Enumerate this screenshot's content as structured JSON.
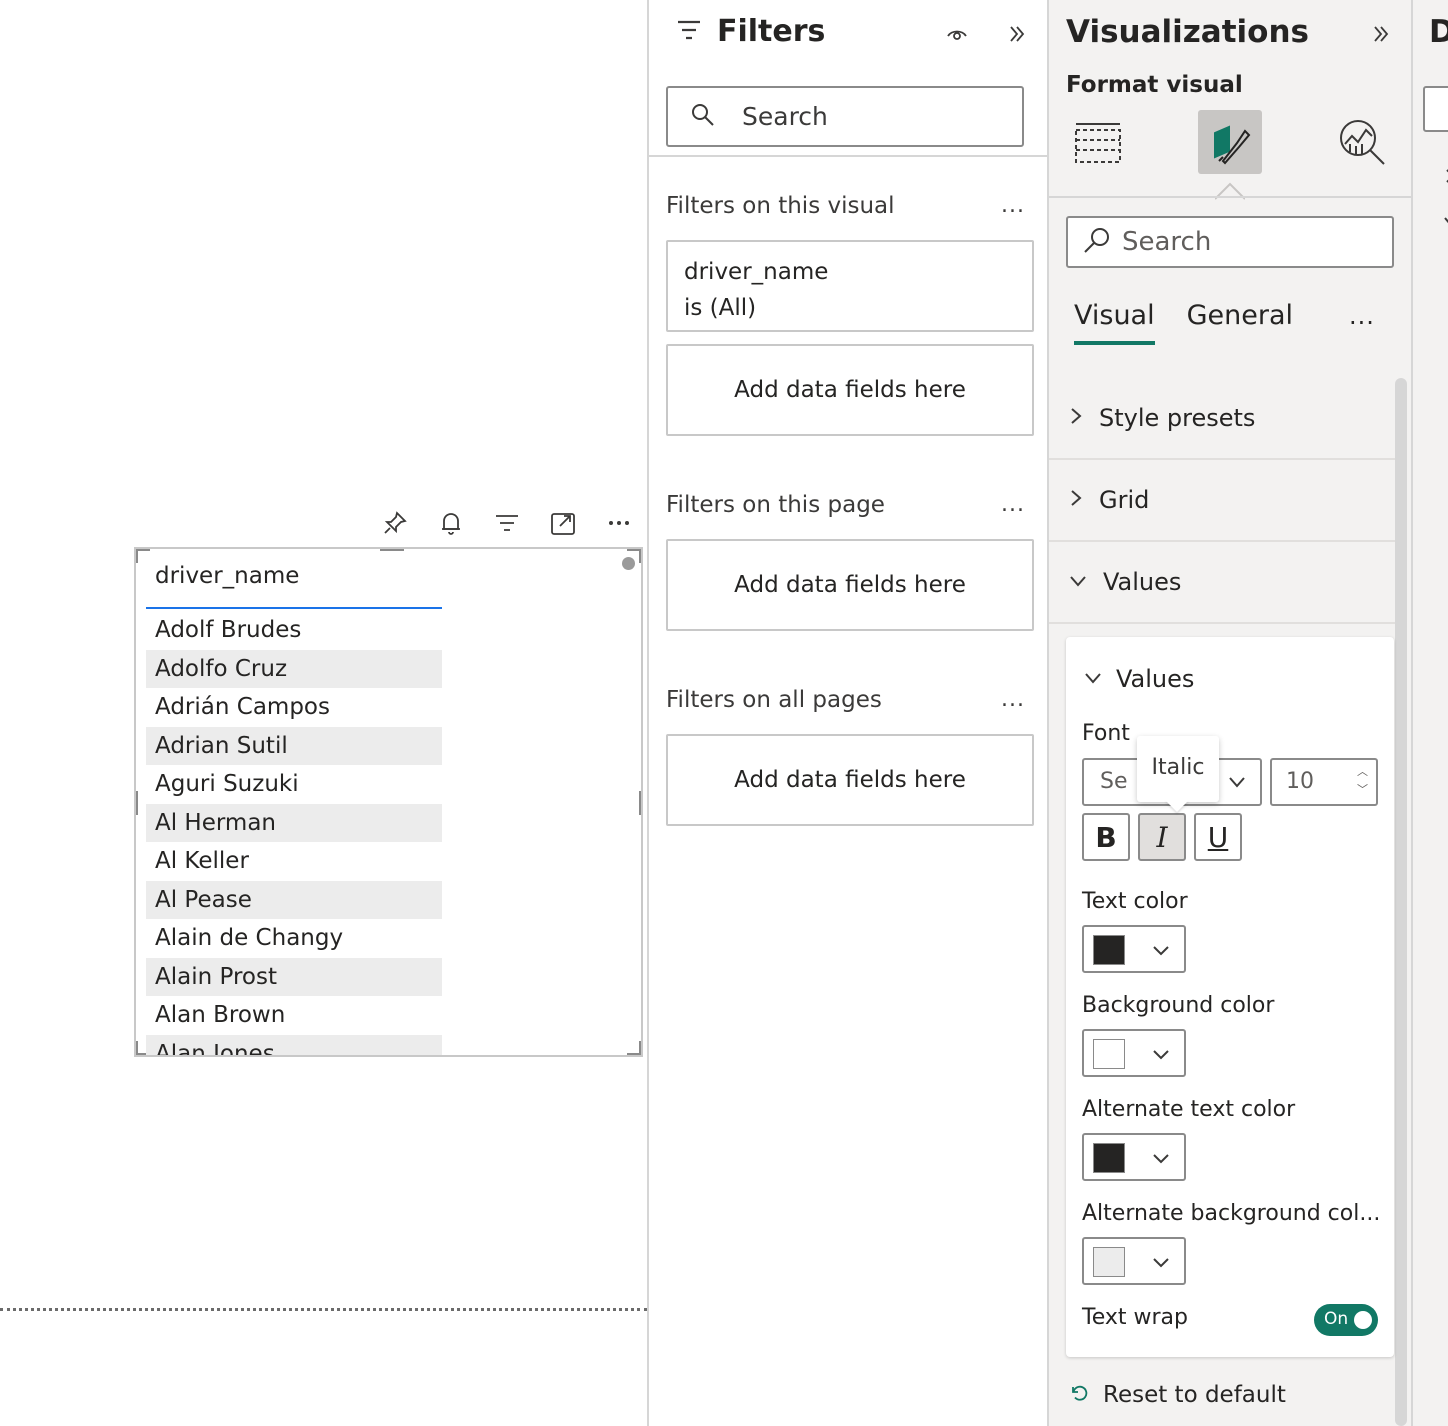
{
  "canvas": {
    "slicer": {
      "header": "driver_name",
      "items": [
        "Adolf Brudes",
        "Adolfo Cruz",
        "Adrián Campos",
        "Adrian Sutil",
        "Aguri Suzuki",
        "Al Herman",
        "Al Keller",
        "Al Pease",
        "Alain de Changy",
        "Alain Prost",
        "Alan Brown",
        "Alan Jones"
      ]
    },
    "visual_header_icons": [
      "pin-icon",
      "bell-icon",
      "filter-icon",
      "focus-mode-icon",
      "more-options-icon"
    ]
  },
  "filters": {
    "title": "Filters",
    "search_placeholder": "Search",
    "visual_section": "Filters on this visual",
    "visual_filter_field": "driver_name",
    "visual_filter_value": "is (All)",
    "add_fields": "Add data fields here",
    "page_section": "Filters on this page",
    "all_pages_section": "Filters on all pages",
    "more": "..."
  },
  "visualizations": {
    "title": "Visualizations",
    "subtitle": "Format visual",
    "search_placeholder": "Search",
    "tabs": [
      "Visual",
      "General"
    ],
    "more": "...",
    "sections": [
      "Style presets",
      "Grid",
      "Values"
    ],
    "values_card": {
      "title": "Values",
      "font_label": "Font",
      "font_value": "Se",
      "font_size": "10",
      "bold": "B",
      "italic": "I",
      "underline": "U",
      "tooltip": "Italic",
      "text_color_label": "Text color",
      "text_color": "#252423",
      "background_color_label": "Background color",
      "background_color": "#ffffff",
      "alt_text_color_label": "Alternate text color",
      "alt_text_color": "#252423",
      "alt_background_label": "Alternate background col...",
      "alt_background_color": "#ececec",
      "text_wrap_label": "Text wrap",
      "text_wrap_state": "On"
    },
    "reset": "Reset to default",
    "accent_color": "#117865"
  },
  "data_pane": {
    "title_partial": "D"
  }
}
